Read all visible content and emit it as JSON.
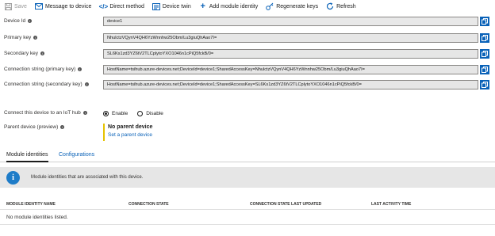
{
  "toolbar": {
    "save": "Save",
    "message": "Message to device",
    "direct_method": "Direct method",
    "device_twin": "Device twin",
    "add_module": "Add module identity",
    "regenerate": "Regenerate keys",
    "refresh": "Refresh"
  },
  "fields": {
    "device_id": {
      "label": "Device Id",
      "value": "device1"
    },
    "primary_key": {
      "label": "Primary key",
      "value": "NhulctzVQynV4QH6YzWnnhw25Obm/Lu3giuQhAao7I="
    },
    "secondary_key": {
      "label": "Secondary key",
      "value": "SL6Ks1zd3YZ6tV2TLCplytoYXO1046n1cPiQ5fckB/0="
    },
    "conn_primary": {
      "label": "Connection string (primary key)",
      "value": "HostName=tsihub.azure-devices.net;DeviceId=device1;SharedAccessKey=NhulctzVQynV4QH6YzWnnhw25Obm/Lu3giuQhAao7I="
    },
    "conn_secondary": {
      "label": "Connection string (secondary key)",
      "value": "HostName=tsihub.azure-devices.net;DeviceId=device1;SharedAccessKey=SL6Ks1zd3YZ6tV2TLCplytoYXO1046n1cPiQ5fckB/0="
    }
  },
  "connect": {
    "label": "Connect this device to an IoT hub",
    "enable": "Enable",
    "disable": "Disable",
    "selected": "Enable"
  },
  "parent": {
    "label": "Parent device (preview)",
    "title": "No parent device",
    "link": "Set a parent device"
  },
  "tabs": {
    "modules": "Module identities",
    "configurations": "Configurations"
  },
  "banner": {
    "text": "Module identities that are associated with this device."
  },
  "table": {
    "columns": [
      "MODULE IDENTITY NAME",
      "CONNECTION STATE",
      "CONNECTION STATE LAST UPDATED",
      "LAST ACTIVITY TIME"
    ],
    "empty": "No module identities listed."
  },
  "colors": {
    "accent": "#0a62b8",
    "parent_bar": "#e5c200",
    "banner_bg": "#e6e6e6",
    "info_icon": "#1e7cc8"
  }
}
